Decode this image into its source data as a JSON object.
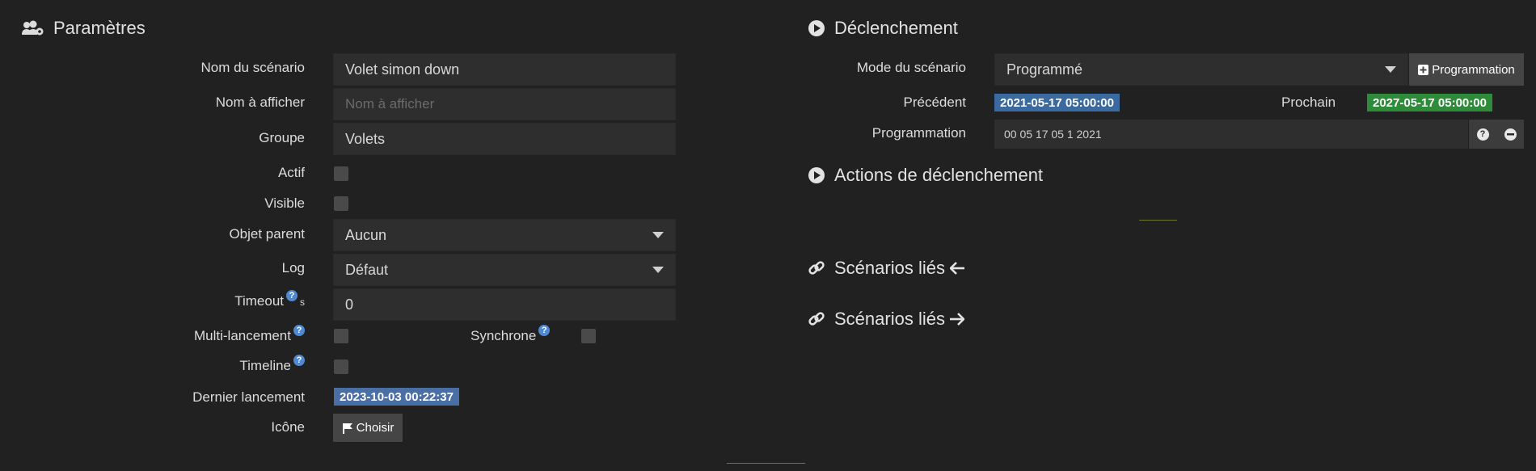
{
  "left": {
    "title": "Paramètres",
    "fields": {
      "name_label": "Nom du scénario",
      "name_value": "Volet simon down",
      "display_label": "Nom à afficher",
      "display_placeholder": "Nom à afficher",
      "group_label": "Groupe",
      "group_value": "Volets",
      "active_label": "Actif",
      "visible_label": "Visible",
      "parent_label": "Objet parent",
      "parent_value": "Aucun",
      "log_label": "Log",
      "log_value": "Défaut",
      "timeout_label": "Timeout",
      "timeout_unit": "s",
      "timeout_value": "0",
      "multi_label": "Multi-lancement",
      "sync_label": "Synchrone",
      "timeline_label": "Timeline",
      "last_run_label": "Dernier lancement",
      "last_run_value": "2023-10-03 00:22:37",
      "icon_label": "Icône",
      "icon_button": "Choisir"
    }
  },
  "right": {
    "trigger_title": "Déclenchement",
    "mode_label": "Mode du scénario",
    "mode_value": "Programmé",
    "programmation_button": "Programmation",
    "previous_label": "Précédent",
    "previous_value": "2021-05-17 05:00:00",
    "next_label": "Prochain",
    "next_value": "2027-05-17 05:00:00",
    "programmation_label": "Programmation",
    "programmation_value": "00 05 17 05 1 2021",
    "actions_title": "Actions de déclenchement",
    "linked_in_title": "Scénarios liés",
    "linked_out_title": "Scénarios liés"
  },
  "icons": {
    "params": "users-cog-icon",
    "trigger": "play-circle-icon",
    "link": "link-icon",
    "arrow_left": "arrow-left-icon",
    "arrow_right": "arrow-right-icon",
    "help": "question-circle-icon",
    "flag": "flag-icon",
    "plus": "plus-square-icon",
    "minus": "minus-circle-icon"
  },
  "colors": {
    "background": "#212121",
    "field": "#2e2e2e",
    "badge_blue": "#3b6aa1",
    "badge_green": "#2e8b3a",
    "help_blue": "#4f89d2"
  }
}
